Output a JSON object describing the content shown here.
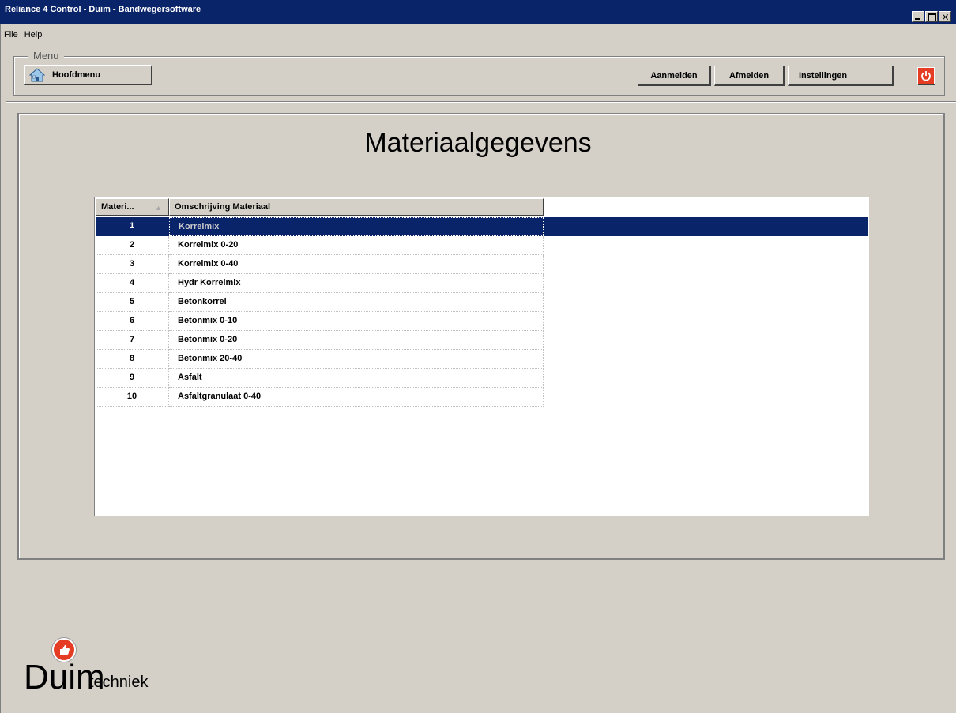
{
  "window": {
    "title": "Reliance 4 Control - Duim - Bandwegersoftware"
  },
  "menubar": {
    "items": [
      "File",
      "Help"
    ]
  },
  "menu_group": {
    "legend": "Menu",
    "home_label": "Hoofdmenu",
    "aanmelden_label": "Aanmelden",
    "afmelden_label": "Afmelden",
    "instellingen_label": "Instellingen"
  },
  "page": {
    "title": "Materiaalgegevens"
  },
  "table": {
    "columns": [
      "Materi...",
      "Omschrijving Materiaal"
    ],
    "sort_indicator": "▲",
    "selected_row": 0,
    "rows": [
      {
        "id": "1",
        "desc": "Korrelmix"
      },
      {
        "id": "2",
        "desc": "Korrelmix 0-20"
      },
      {
        "id": "3",
        "desc": "Korrelmix 0-40"
      },
      {
        "id": "4",
        "desc": "Hydr Korrelmix"
      },
      {
        "id": "5",
        "desc": "Betonkorrel"
      },
      {
        "id": "6",
        "desc": "Betonmix 0-10"
      },
      {
        "id": "7",
        "desc": "Betonmix 0-20"
      },
      {
        "id": "8",
        "desc": "Betonmix 20-40"
      },
      {
        "id": "9",
        "desc": "Asfalt"
      },
      {
        "id": "10",
        "desc": "Asfaltgranulaat 0-40"
      }
    ]
  },
  "logo": {
    "word": "Duim",
    "sub": "techniek"
  },
  "colors": {
    "titlebar": "#0a246a",
    "selection": "#0a246a",
    "accent_red": "#e53d24",
    "face": "#d4d0c8"
  }
}
